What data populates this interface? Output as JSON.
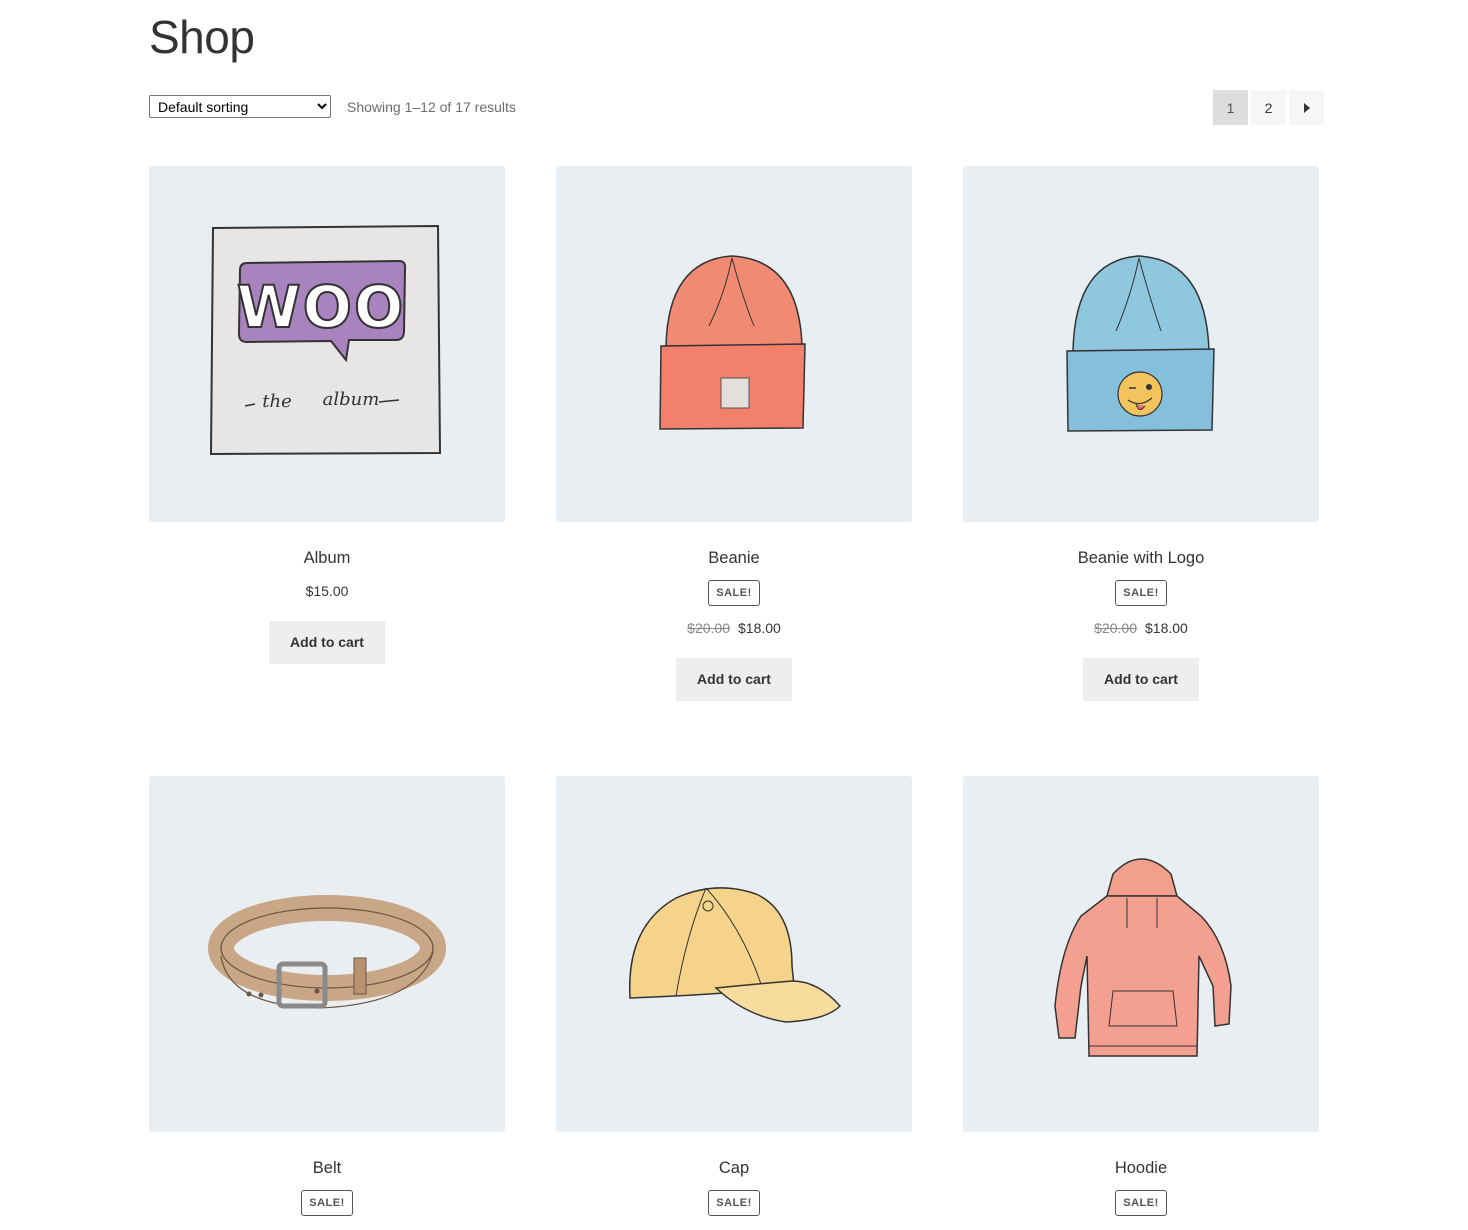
{
  "page": {
    "title": "Shop"
  },
  "toolbar": {
    "sort_options": [
      "Default sorting"
    ],
    "sort_selected": "Default sorting",
    "result_count": "Showing 1–12 of 17 results"
  },
  "pagination": {
    "pages": [
      "1",
      "2"
    ],
    "current": "1",
    "next_icon": "arrow-right-icon"
  },
  "products": [
    {
      "name": "Album",
      "sale": false,
      "price": "$15.00",
      "button": "Add to cart",
      "image": "album-image"
    },
    {
      "name": "Beanie",
      "sale": true,
      "sale_label": "SALE!",
      "old_price": "$20.00",
      "price": "$18.00",
      "button": "Add to cart",
      "image": "beanie-image"
    },
    {
      "name": "Beanie with Logo",
      "sale": true,
      "sale_label": "SALE!",
      "old_price": "$20.00",
      "price": "$18.00",
      "button": "Add to cart",
      "image": "beanie-with-logo-image"
    },
    {
      "name": "Belt",
      "sale": true,
      "sale_label": "SALE!",
      "image": "belt-image"
    },
    {
      "name": "Cap",
      "sale": true,
      "sale_label": "SALE!",
      "image": "cap-image"
    },
    {
      "name": "Hoodie",
      "sale": true,
      "sale_label": "SALE!",
      "image": "hoodie-image"
    }
  ],
  "colors": {
    "image_background": "#e9eef2",
    "button_background": "#eeeeee",
    "current_page_background": "#dddddd"
  }
}
